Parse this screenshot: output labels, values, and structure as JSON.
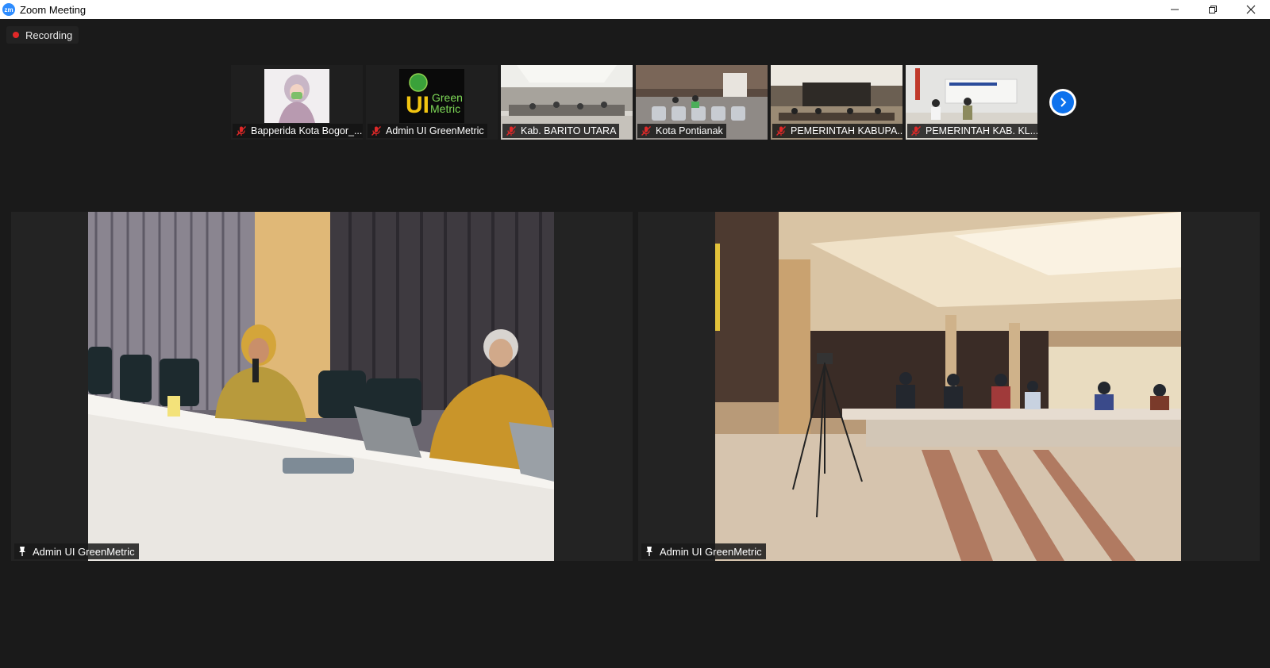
{
  "window": {
    "app_logo": "zm",
    "title": "Zoom Meeting",
    "controls": [
      "minimize-icon",
      "restore-icon",
      "close-icon"
    ]
  },
  "recording": {
    "label": "Recording",
    "color": "#e02828"
  },
  "thumbnails": [
    {
      "name": "Bapperida Kota Bogor_...",
      "muted": true
    },
    {
      "name": "Admin UI GreenMetric",
      "muted": true,
      "logo": {
        "line1": "UI",
        "line2": "Green",
        "line3": "Metric"
      }
    },
    {
      "name": "Kab. BARITO UTARA",
      "muted": true
    },
    {
      "name": "Kota Pontianak",
      "muted": true
    },
    {
      "name": "PEMERINTAH KABUPA...",
      "muted": true
    },
    {
      "name": "PEMERINTAH KAB. KL...",
      "muted": true
    }
  ],
  "strip_next_icon": "chevron-right-icon",
  "tiles": [
    {
      "name": "Admin UI GreenMetric",
      "icon": "pin-icon"
    },
    {
      "name": "Admin UI GreenMetric",
      "icon": "pin-icon"
    }
  ],
  "colors": {
    "accent": "#0e72ed",
    "background": "#1a1a1a",
    "muted_icon": "#e02828"
  }
}
